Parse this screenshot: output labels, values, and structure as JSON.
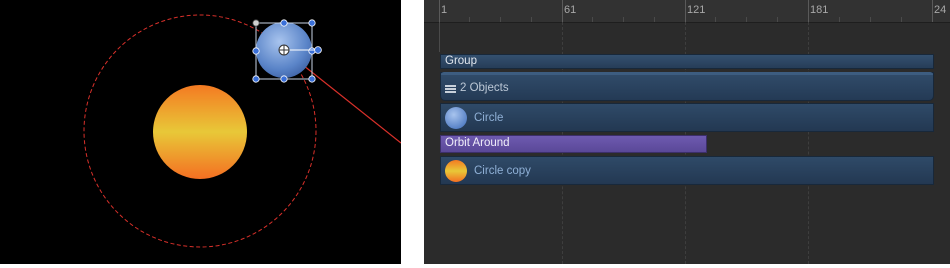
{
  "canvas": {
    "background": "#000000",
    "orbit_path_color": "#d8302a",
    "sun_gradient": [
      "#f47a22",
      "#e8c838",
      "#f46f22"
    ],
    "planet_gradient": [
      "#a8c4ee",
      "#5a84c8"
    ],
    "handle_color": "#3a6fd8"
  },
  "timeline": {
    "ruler": {
      "ticks": [
        "1",
        "61",
        "121",
        "181",
        "24"
      ]
    },
    "tracks": {
      "group_label": "Group",
      "objects_label": "2 Objects",
      "circle_label": "Circle",
      "behavior_label": "Orbit Around",
      "circle_copy_label": "Circle copy"
    },
    "colors": {
      "layer_bar": "#2f4a68",
      "behavior_bar": "#6e5ab0",
      "background": "#2b2b2b"
    }
  }
}
